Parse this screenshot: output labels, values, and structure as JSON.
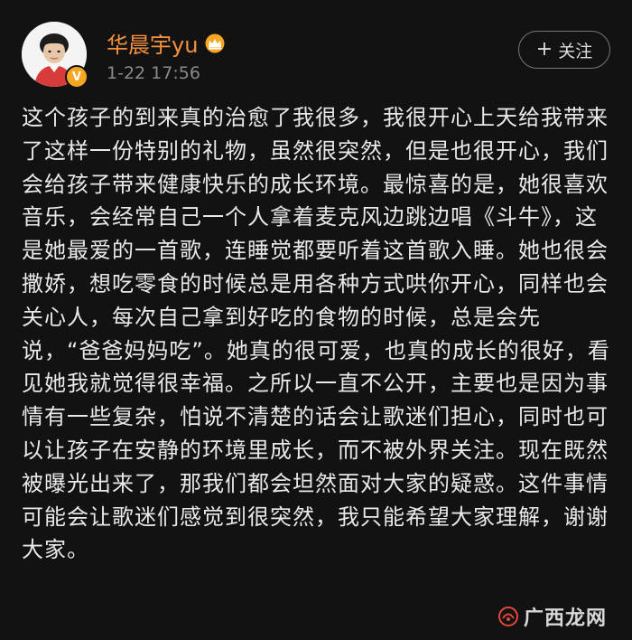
{
  "user": {
    "name": "华晨宇yu",
    "time": "1-22 17:56",
    "vip_badge": "V"
  },
  "actions": {
    "follow_label": "关注"
  },
  "post": {
    "text": "这个孩子的到来真的治愈了我很多，我很开心上天给我带来了这样一份特别的礼物，虽然很突然，但是也很开心，我们会给孩子带来健康快乐的成长环境。最惊喜的是，她很喜欢音乐，会经常自己一个人拿着麦克风边跳边唱《斗牛》，这是她最爱的一首歌，连睡觉都要听着这首歌入睡。她也很会撒娇，想吃零食的时候总是用各种方式哄你开心，同样也会关心人，每次自己拿到好吃的食物的时候，总是会先说，“爸爸妈妈吃”。她真的很可爱，也真的成长的很好，看见她我就觉得很幸福。之所以一直不公开，主要也是因为事情有一些复杂，怕说不清楚的话会让歌迷们担心，同时也可以让孩子在安静的环境里成长，而不被外界关注。现在既然被曝光出来了，那我们都会坦然面对大家的疑惑。这件事情可能会让歌迷们感觉到很突然，我只能希望大家理解，谢谢大家。"
  },
  "watermark": {
    "text": "广西龙网"
  },
  "colors": {
    "background": "#121212",
    "username": "#f5903d",
    "badge": "#f6a623",
    "body_text": "#e9e9e9",
    "time_text": "#8a8a8a"
  },
  "icons": {
    "crown": "crown-icon",
    "plus": "plus-icon",
    "vip": "vip-badge-icon",
    "watermark_logo": "watermark-logo-icon"
  }
}
